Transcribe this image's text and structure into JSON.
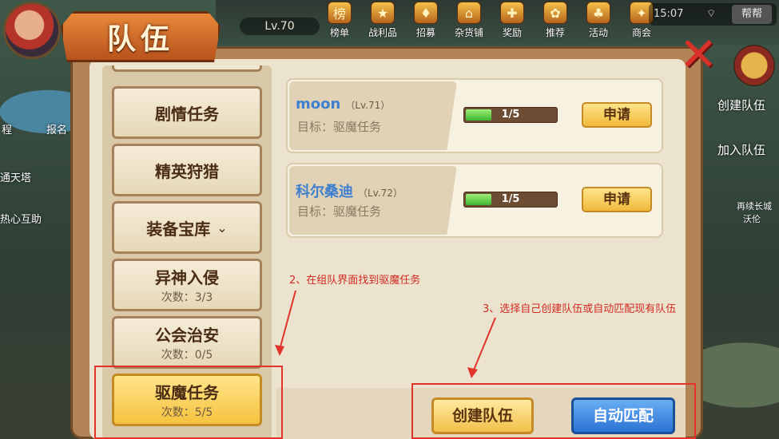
{
  "header": {
    "title": "队伍",
    "level": "Lv.70",
    "time": "15:07",
    "wifi": "⌔",
    "help_label": "帮帮",
    "top_icons": [
      {
        "label": "榜单",
        "icon": "ranking-icon",
        "glyph": "榜"
      },
      {
        "label": "战利品",
        "icon": "loot-icon",
        "glyph": "★"
      },
      {
        "label": "招募",
        "icon": "recruit-icon",
        "glyph": "♦"
      },
      {
        "label": "杂货铺",
        "icon": "shop-icon",
        "glyph": "⌂"
      },
      {
        "label": "奖励",
        "icon": "gift-icon",
        "glyph": "✚"
      },
      {
        "label": "推荐",
        "icon": "recommend-icon",
        "glyph": "✿"
      },
      {
        "label": "活动",
        "icon": "event-icon",
        "glyph": "♣"
      },
      {
        "label": "商会",
        "icon": "guild-shop-icon",
        "glyph": "✦"
      }
    ]
  },
  "left_side": {
    "entries": [
      {
        "label": "程"
      },
      {
        "label": "报名"
      },
      {
        "label": "通天塔"
      },
      {
        "label": "热心互助"
      }
    ]
  },
  "right_side": {
    "create_team": "创建队伍",
    "join_team": "加入队伍",
    "small_label_1": "再续长城",
    "small_label_2": "沃伦"
  },
  "categories": [
    {
      "name": "剧情任务",
      "sub": ""
    },
    {
      "name": "精英狩猎",
      "sub": ""
    },
    {
      "name": "装备宝库",
      "sub": "",
      "chevron": "⌄"
    },
    {
      "name": "异神入侵",
      "sub": "次数：3/3"
    },
    {
      "name": "公会治安",
      "sub": "次数：0/5"
    },
    {
      "name": "驱魔任务",
      "sub": "次数：5/5",
      "active": true
    }
  ],
  "teams": [
    {
      "leader": "moon",
      "level": "（Lv.71）",
      "goal": "目标：驱魔任务",
      "members": "1/5",
      "fill": 0.2,
      "apply_label": "申请"
    },
    {
      "leader": "科尔桑迪",
      "level": "（Lv.72）",
      "goal": "目标：驱魔任务",
      "members": "1/5",
      "fill": 0.2,
      "apply_label": "申请"
    }
  ],
  "actions": {
    "create_label": "创建队伍",
    "auto_match_label": "自动匹配"
  },
  "annotations": {
    "step2": "2、在组队界面找到驱魔任务",
    "step3": "3、选择自己创建队伍或自动匹配现有队伍"
  },
  "colors": {
    "annotation_red": "#e0342b",
    "leader_blue": "#3f7fcf",
    "active_gold": "#f6c23e",
    "auto_blue": "#2b73d6"
  }
}
